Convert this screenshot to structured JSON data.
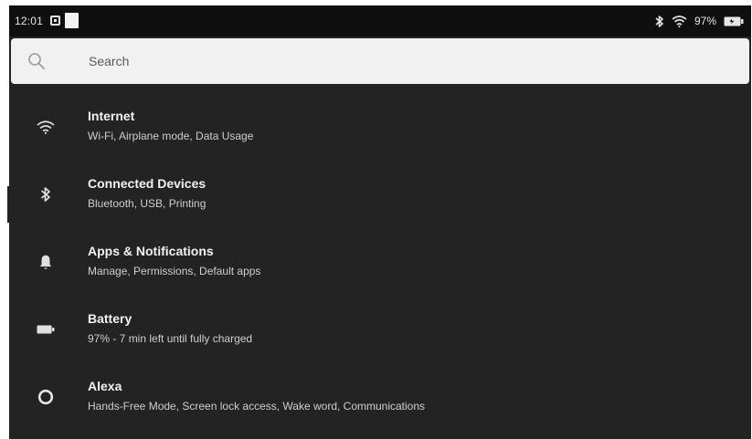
{
  "status_bar": {
    "time": "12:01",
    "battery_percent": "97%",
    "icons": [
      "notification-icon",
      "notification-icon",
      "bluetooth-icon",
      "wifi-icon",
      "battery-icon"
    ]
  },
  "search": {
    "placeholder": "Search",
    "icon": "search-icon"
  },
  "settings": {
    "items": [
      {
        "title": "Internet",
        "subtitle": "Wi-Fi, Airplane mode, Data Usage",
        "icon": "wifi-icon"
      },
      {
        "title": "Connected Devices",
        "subtitle": "Bluetooth, USB, Printing",
        "icon": "bluetooth-icon"
      },
      {
        "title": "Apps & Notifications",
        "subtitle": "Manage, Permissions, Default apps",
        "icon": "bell-icon"
      },
      {
        "title": "Battery",
        "subtitle": "97% - 7 min left until fully charged",
        "icon": "battery-icon"
      },
      {
        "title": "Alexa",
        "subtitle": "Hands-Free Mode, Screen lock access, Wake word, Communications",
        "icon": "alexa-icon"
      }
    ]
  },
  "colors": {
    "background": "#232323",
    "status_bar": "#0f0f0f",
    "search_bar": "#f1f1f1",
    "title_text": "#f2f2f2",
    "subtitle_text": "#cfcfcf"
  }
}
